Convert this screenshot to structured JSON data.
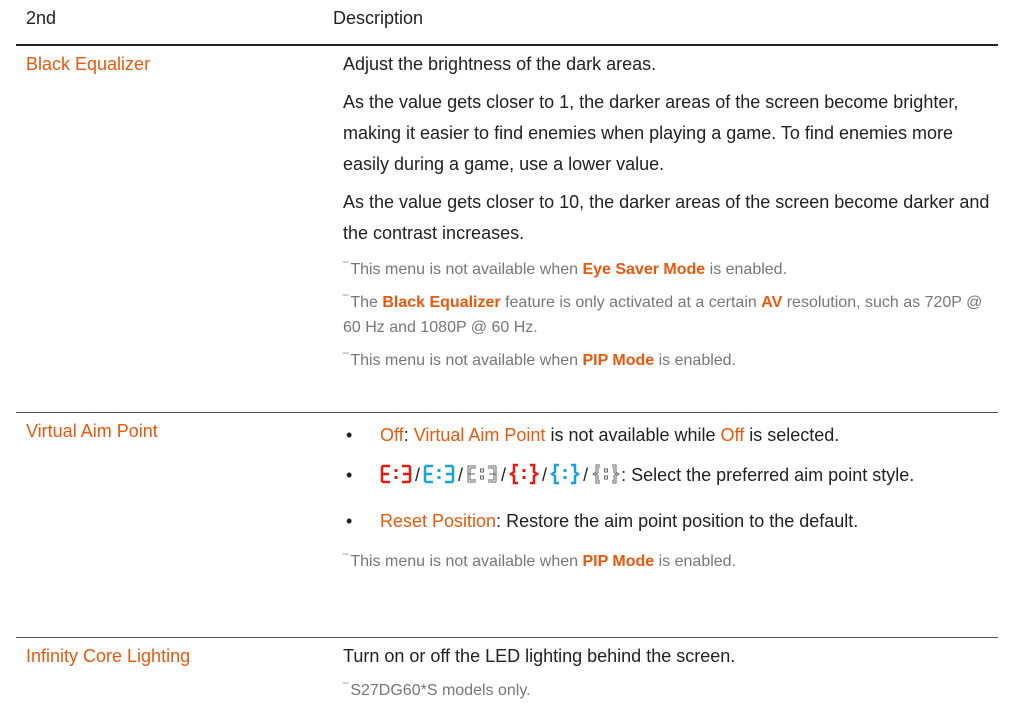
{
  "header": {
    "col1": "2nd",
    "col2": "Description"
  },
  "colors": {
    "accent": "#e8590c",
    "text": "#222222",
    "note": "#777777",
    "aim_blue": "#1ba1e2"
  },
  "rows": {
    "black_equalizer": {
      "label": "Black Equalizer",
      "p1": "Adjust the brightness of the dark areas.",
      "p2": "As the value gets closer to 1, the darker areas of the screen become brighter, making it easier to find enemies when playing a game. To find enemies more easily during a game, use a lower value.",
      "p3": "As the value gets closer to 10, the darker areas of the screen become darker and the contrast increases.",
      "n1": {
        "pre": "This menu is not available when ",
        "hl": "Eye Saver Mode",
        "post": " is enabled."
      },
      "n2": {
        "pre": "The ",
        "hl": "Black Equalizer",
        "mid": " feature is only activated at a certain ",
        "hl2": "AV",
        "post": " resolution, such as 720P @ 60 Hz and 1080P @ 60 Hz."
      },
      "n3": {
        "pre": "This menu is not available when ",
        "hl": "PIP Mode",
        "post": " is enabled."
      }
    },
    "virtual_aim": {
      "label": "Virtual Aim Point",
      "b1": {
        "hl": "Off",
        "colon": ": ",
        "hl2": "Virtual Aim Point",
        "mid": " is not available while ",
        "hl3": "Off",
        "post": " is selected."
      },
      "b2": {
        "post": ": Select the preferred aim point style."
      },
      "b3": {
        "hl": "Reset Position",
        "post": ": Restore the aim point position to the default."
      },
      "n1": {
        "pre": "This menu is not available when ",
        "hl": "PIP Mode",
        "post": " is enabled."
      }
    },
    "infinity": {
      "label": "Infinity Core Lighting",
      "p1": "Turn on or off the LED lighting behind the screen.",
      "n1": "S27DG60*S models only."
    }
  },
  "aim_icons": [
    "aim-square-red",
    "aim-square-blue",
    "aim-square-grey",
    "aim-bracket-red",
    "aim-bracket-blue",
    "aim-bracket-grey"
  ]
}
